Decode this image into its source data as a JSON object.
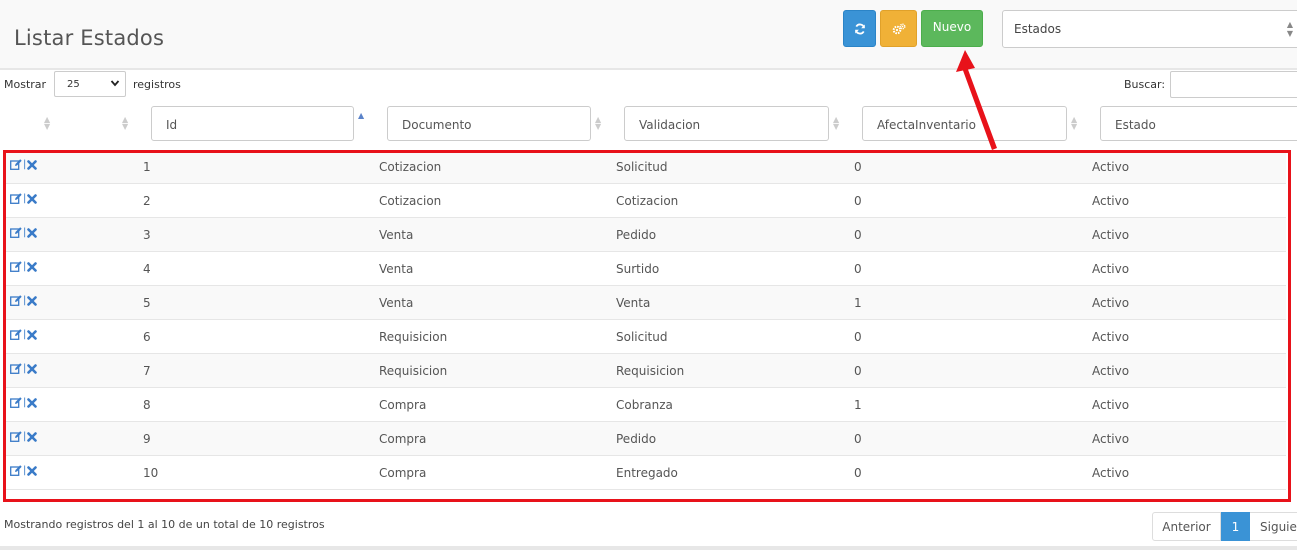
{
  "header": {
    "title": "Listar Estados",
    "new_label": "Nuevo",
    "module_select": "Estados"
  },
  "controls": {
    "show_label": "Mostrar",
    "page_size": "25",
    "records_label": "registros",
    "search_label": "Buscar:"
  },
  "filters": {
    "id": "Id",
    "documento": "Documento",
    "validacion": "Validacion",
    "afecta_inventario": "AfectaInventario",
    "estado": "Estado"
  },
  "rows": [
    {
      "id": "1",
      "documento": "Cotizacion",
      "validacion": "Solicitud",
      "afecta": "0",
      "estado": "Activo"
    },
    {
      "id": "2",
      "documento": "Cotizacion",
      "validacion": "Cotizacion",
      "afecta": "0",
      "estado": "Activo"
    },
    {
      "id": "3",
      "documento": "Venta",
      "validacion": "Pedido",
      "afecta": "0",
      "estado": "Activo"
    },
    {
      "id": "4",
      "documento": "Venta",
      "validacion": "Surtido",
      "afecta": "0",
      "estado": "Activo"
    },
    {
      "id": "5",
      "documento": "Venta",
      "validacion": "Venta",
      "afecta": "1",
      "estado": "Activo"
    },
    {
      "id": "6",
      "documento": "Requisicion",
      "validacion": "Solicitud",
      "afecta": "0",
      "estado": "Activo"
    },
    {
      "id": "7",
      "documento": "Requisicion",
      "validacion": "Requisicion",
      "afecta": "0",
      "estado": "Activo"
    },
    {
      "id": "8",
      "documento": "Compra",
      "validacion": "Cobranza",
      "afecta": "1",
      "estado": "Activo"
    },
    {
      "id": "9",
      "documento": "Compra",
      "validacion": "Pedido",
      "afecta": "0",
      "estado": "Activo"
    },
    {
      "id": "10",
      "documento": "Compra",
      "validacion": "Entregado",
      "afecta": "0",
      "estado": "Activo"
    }
  ],
  "footer": {
    "info": "Mostrando registros del 1 al 10 de un total de 10 registros",
    "prev": "Anterior",
    "page": "1",
    "next": "Siguiente"
  },
  "icons": {
    "refresh": "refresh-icon",
    "config": "cogs-icon",
    "edit": "edit-icon",
    "delete": "delete-icon"
  },
  "colors": {
    "primary": "#3a93d6",
    "warning": "#f0b137",
    "success": "#5cb85c",
    "highlight": "#e8121a"
  }
}
